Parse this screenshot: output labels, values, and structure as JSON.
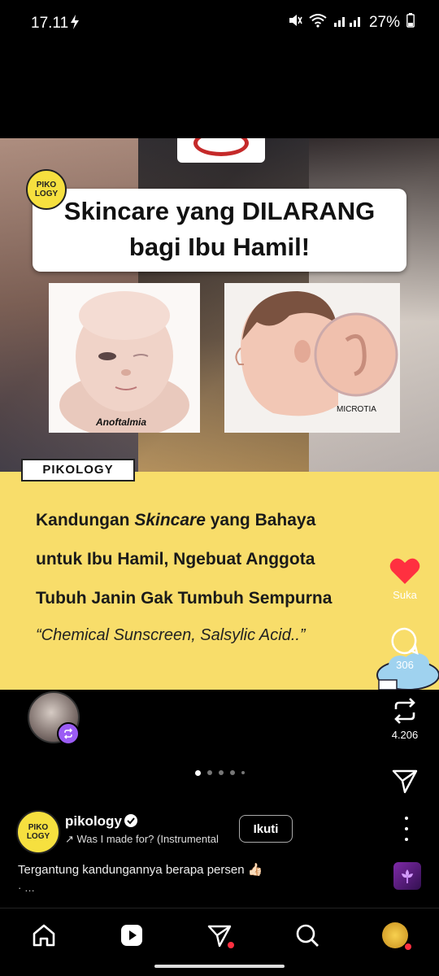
{
  "status_bar": {
    "time": "17.11",
    "battery": "27%"
  },
  "post": {
    "image_headline_line1": "Skincare yang DILARANG",
    "image_headline_line2": "bagi Ibu Hamil!",
    "logo_text": "PIKO LOGY",
    "pic1_caption": "Anoftalmia",
    "pic2_caption": "MICROTIA",
    "brand_bar": "PIKOLOGY",
    "title_line1_a": "Kandungan ",
    "title_line1_b": "Skincare",
    "title_line1_c": " yang Bahaya",
    "title_line2": "untuk Ibu Hamil, Ngebuat Anggota",
    "title_line3": "Tubuh Janin Gak Tumbuh Sempurna",
    "quote": "“Chemical Sunscreen, Salsylic Acid..”"
  },
  "actions": {
    "like_label": "Suka",
    "comment_count": "306",
    "repost_count": "4.206"
  },
  "carousel": {
    "count": 5,
    "active": 0
  },
  "author": {
    "username": "pikology",
    "audio": "↗ Was I made for? (Instrumental",
    "follow_label": "Ikuti"
  },
  "caption": {
    "text": "Tergantung kandungannya berapa persen 👍🏻",
    "more": "· …"
  },
  "colors": {
    "accent_yellow": "#f8dd6a",
    "like_red": "#ff3040",
    "repost_purple": "#9b5cf5"
  }
}
